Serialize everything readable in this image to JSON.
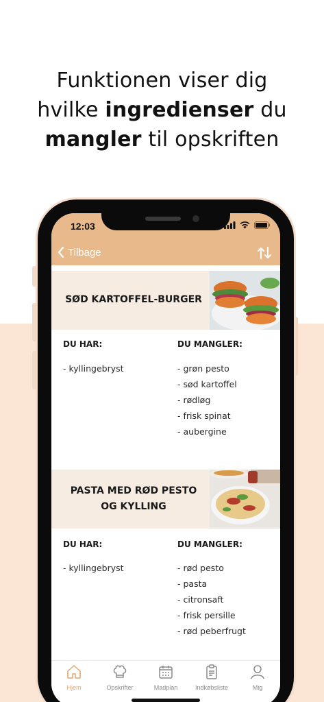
{
  "headline": {
    "line1": "Funktionen viser dig",
    "line2_pre": "hvilke ",
    "line2_bold": "ingredienser",
    "line2_post": " du",
    "line3_bold": "mangler",
    "line3_post": " til opskriften"
  },
  "status": {
    "time": "12:03"
  },
  "nav": {
    "back_label": "Tilbage",
    "sort_icon": "sort-arrows-icon"
  },
  "recipes": [
    {
      "title_line1": "SØD KARTOFFEL-BURGER",
      "title_line2": "",
      "have_header": "DU HAR:",
      "missing_header": "DU MANGLER:",
      "have": [
        "kyllingebryst"
      ],
      "missing": [
        "grøn pesto",
        "sød kartoffel",
        "rødløg",
        "frisk spinat",
        "aubergine"
      ]
    },
    {
      "title_line1": "PASTA MED RØD PESTO",
      "title_line2": "OG KYLLING",
      "have_header": "DU HAR:",
      "missing_header": "DU MANGLER:",
      "have": [
        "kyllingebryst"
      ],
      "missing": [
        "rød pesto",
        "pasta",
        "citronsaft",
        "frisk persille",
        "rød peberfrugt"
      ]
    }
  ],
  "item_prefix": "- ",
  "tabs": [
    {
      "label": "Hjem",
      "icon": "home-icon",
      "active": true
    },
    {
      "label": "Opskrifter",
      "icon": "chef-hat-icon",
      "active": false
    },
    {
      "label": "Madplan",
      "icon": "calendar-icon",
      "active": false
    },
    {
      "label": "Indkøbsliste",
      "icon": "clipboard-list-icon",
      "active": false
    },
    {
      "label": "Mig",
      "icon": "person-icon",
      "active": false
    }
  ],
  "colors": {
    "accent": "#e8b98a",
    "peach_bg": "#fbe6d6",
    "recipe_header_bg": "#f7ece2",
    "active_tab": "#e3a76b"
  }
}
